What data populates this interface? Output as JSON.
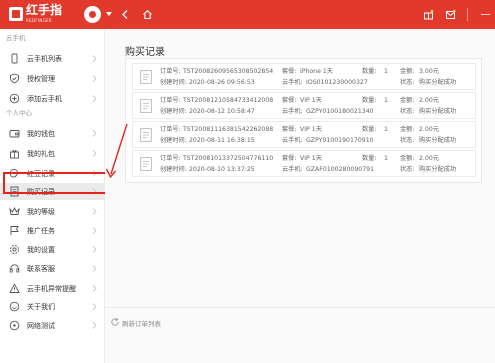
{
  "app": {
    "logo_text": "红手指",
    "logo_sub": "REDFINGER"
  },
  "sidebar": {
    "section_cloud": "云手机",
    "section_personal": "个人中心",
    "items": [
      {
        "label": "云手机列表",
        "icon": "phone-icon"
      },
      {
        "label": "授权管理",
        "icon": "shield-icon"
      },
      {
        "label": "添加云手机",
        "icon": "plus-circle-icon"
      },
      {
        "label": "我的钱包",
        "icon": "wallet-icon"
      },
      {
        "label": "我的礼包",
        "icon": "gift-icon"
      },
      {
        "label": "红豆记录",
        "icon": "bean-icon"
      },
      {
        "label": "购买记录",
        "icon": "receipt-icon"
      },
      {
        "label": "我的等级",
        "icon": "crown-icon"
      },
      {
        "label": "推广任务",
        "icon": "flag-icon"
      },
      {
        "label": "我的设置",
        "icon": "gear-icon"
      },
      {
        "label": "联系客服",
        "icon": "headset-icon"
      },
      {
        "label": "云手机异常提醒",
        "icon": "warning-icon"
      },
      {
        "label": "关于我们",
        "icon": "smile-icon"
      },
      {
        "label": "网络测试",
        "icon": "network-icon"
      }
    ],
    "active_index": 6
  },
  "main": {
    "title": "购买记录",
    "refresh_label": "刷新订单列表",
    "records": [
      {
        "order_label": "订单号:",
        "order_no": "TST20082609565308502854",
        "created_label": "创建时间:",
        "created": "2020-08-26 09:56:53",
        "pkg_label": "套餐:",
        "pkg": "iPhone 1天",
        "qty_label": "数量:",
        "qty": "1",
        "phone_label": "云手机:",
        "phone": "IOS0101230000327",
        "amount_label": "金额:",
        "amount": "3.00元",
        "status_label": "状态:",
        "status": "购买分配成功"
      },
      {
        "order_label": "订单号:",
        "order_no": "TST20081210584733412008",
        "created_label": "创建时间:",
        "created": "2020-08-12 10:58:47",
        "pkg_label": "套餐:",
        "pkg": "VIP 1天",
        "qty_label": "数量:",
        "qty": "1",
        "phone_label": "云手机:",
        "phone": "GZPY0100180021340",
        "amount_label": "金额:",
        "amount": "2.00元",
        "status_label": "状态:",
        "status": "购买分配成功"
      },
      {
        "order_label": "订单号:",
        "order_no": "TST20081116381542262088",
        "created_label": "创建时间:",
        "created": "2020-08-11 16:38:15",
        "pkg_label": "套餐:",
        "pkg": "VIP 1天",
        "qty_label": "数量:",
        "qty": "1",
        "phone_label": "云手机:",
        "phone": "GZPY0100190170910",
        "amount_label": "金额:",
        "amount": "2.00元",
        "status_label": "状态:",
        "status": "购买分配成功"
      },
      {
        "order_label": "订单号:",
        "order_no": "TST20081013372504776110",
        "created_label": "创建时间:",
        "created": "2020-08-10 13:37:25",
        "pkg_label": "套餐:",
        "pkg": "VIP 1天",
        "qty_label": "数量:",
        "qty": "1",
        "phone_label": "云手机:",
        "phone": "GZAF0100280090791",
        "amount_label": "金额:",
        "amount": "2.00元",
        "status_label": "状态:",
        "status": "购买分配成功"
      }
    ]
  },
  "colors": {
    "brand": "#e2392d",
    "status": "#f0882b",
    "highlight": "#e2261d"
  }
}
